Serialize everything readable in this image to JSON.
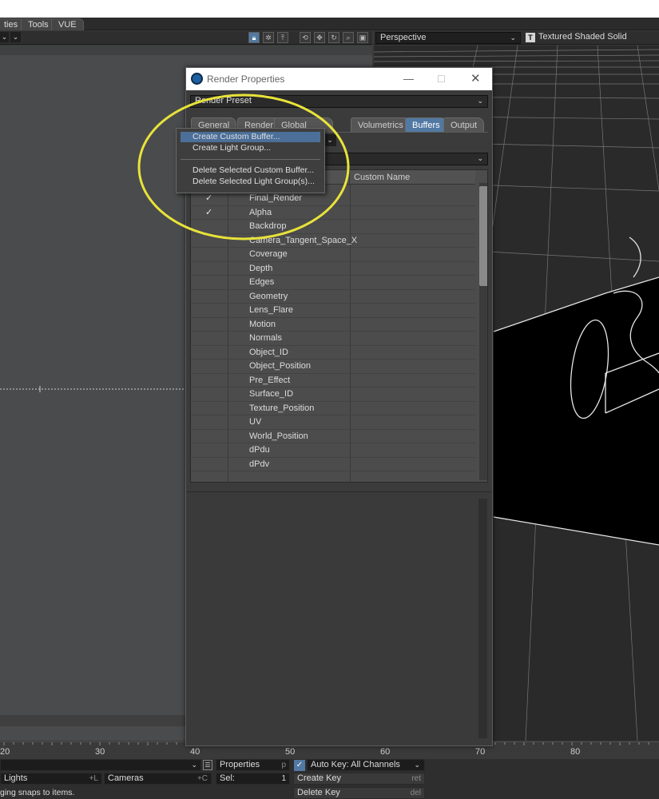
{
  "menubar": {
    "tabs": [
      "ties",
      "Tools",
      "VUE"
    ]
  },
  "left_viewport": {
    "toolbar_icons": [
      "lock-icon",
      "gear-icon",
      "export-icon",
      "rotate-icon",
      "move-icon",
      "refresh-icon",
      "zoom-icon",
      "maximize-icon"
    ]
  },
  "right_viewport": {
    "view_select": "Perspective",
    "shading_mode": "Textured Shaded Solid",
    "shading_icon_glyph": "T"
  },
  "dialog": {
    "title": "Render Properties",
    "preset": "Render Preset",
    "tabs": [
      {
        "label": "General",
        "active": false
      },
      {
        "label": "Render",
        "active": false
      },
      {
        "label": "Global Illumination",
        "active": false
      },
      {
        "label": "Volumetrics",
        "active": false
      },
      {
        "label": "Buffers",
        "active": true
      },
      {
        "label": "Output",
        "active": false
      }
    ],
    "list_header": {
      "col_custom": "Custom Name"
    },
    "buffers": [
      {
        "name": "Final_Render",
        "check": "✓"
      },
      {
        "name": "Alpha",
        "check": "✓"
      },
      {
        "name": "Backdrop",
        "check": ""
      },
      {
        "name": "Camera_Tangent_Space_X",
        "check": ""
      },
      {
        "name": "Coverage",
        "check": ""
      },
      {
        "name": "Depth",
        "check": ""
      },
      {
        "name": "Edges",
        "check": ""
      },
      {
        "name": "Geometry",
        "check": ""
      },
      {
        "name": "Lens_Flare",
        "check": ""
      },
      {
        "name": "Motion",
        "check": ""
      },
      {
        "name": "Normals",
        "check": ""
      },
      {
        "name": "Object_ID",
        "check": ""
      },
      {
        "name": "Object_Position",
        "check": ""
      },
      {
        "name": "Pre_Effect",
        "check": ""
      },
      {
        "name": "Surface_ID",
        "check": ""
      },
      {
        "name": "Texture_Position",
        "check": ""
      },
      {
        "name": "UV",
        "check": ""
      },
      {
        "name": "World_Position",
        "check": ""
      },
      {
        "name": "dPdu",
        "check": ""
      },
      {
        "name": "dPdv",
        "check": ""
      }
    ]
  },
  "context_menu": {
    "items": [
      "Create Custom Buffer...",
      "Create Light Group...",
      "Delete Selected Custom Buffer...",
      "Delete Selected Light Group(s)..."
    ],
    "highlight_color": "#4b6f99"
  },
  "annotation": {
    "color": "#e8e33a"
  },
  "timeline": {
    "ticks": [
      "20",
      "30",
      "40",
      "50",
      "60",
      "70",
      "80"
    ]
  },
  "bottom": {
    "properties_label": "Properties",
    "properties_key": "p",
    "autokey_label": "Auto Key: All Channels",
    "lights_label": "Lights",
    "lights_key": "+L",
    "cameras_label": "Cameras",
    "cameras_key": "+C",
    "sel_label": "Sel:",
    "sel_value": "1",
    "create_key_label": "Create Key",
    "create_key_key": "ret",
    "delete_key_label": "Delete Key",
    "delete_key_key": "del",
    "status_text": "ging snaps to items."
  }
}
